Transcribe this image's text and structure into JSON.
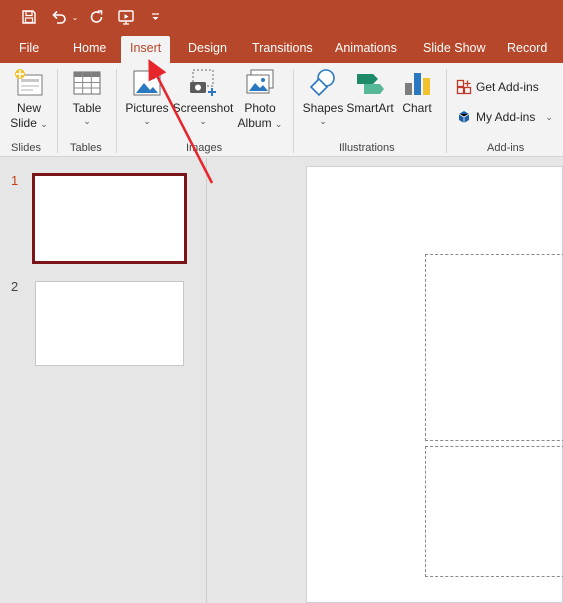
{
  "quick_access": {
    "icons": [
      "save-icon",
      "undo-icon",
      "undo-dropdown-icon",
      "redo-icon",
      "start-from-beginning-icon",
      "customize-toolbar-icon"
    ]
  },
  "tabs": [
    {
      "label": "File",
      "active": false
    },
    {
      "label": "Home",
      "active": false
    },
    {
      "label": "Insert",
      "active": true
    },
    {
      "label": "Design",
      "active": false
    },
    {
      "label": "Transitions",
      "active": false
    },
    {
      "label": "Animations",
      "active": false
    },
    {
      "label": "Slide Show",
      "active": false
    },
    {
      "label": "Record",
      "active": false
    }
  ],
  "ribbon": {
    "slides": {
      "group_label": "Slides",
      "new_slide_line1": "New",
      "new_slide_line2": "Slide"
    },
    "tables": {
      "group_label": "Tables",
      "table": "Table"
    },
    "images": {
      "group_label": "Images",
      "pictures": "Pictures",
      "screenshot": "Screenshot",
      "photo_album_line1": "Photo",
      "photo_album_line2": "Album"
    },
    "illustrations": {
      "group_label": "Illustrations",
      "shapes": "Shapes",
      "smartart": "SmartArt",
      "chart": "Chart"
    },
    "addins": {
      "group_label": "Add-ins",
      "get_addins": "Get Add-ins",
      "my_addins": "My Add-ins"
    }
  },
  "slides_pane": {
    "thumbnails": [
      {
        "number": "1",
        "selected": true
      },
      {
        "number": "2",
        "selected": false
      }
    ]
  },
  "colors": {
    "brand": "#b7472a",
    "selected_thumb_border": "#7a1416",
    "annotation_arrow": "#e8252a"
  }
}
